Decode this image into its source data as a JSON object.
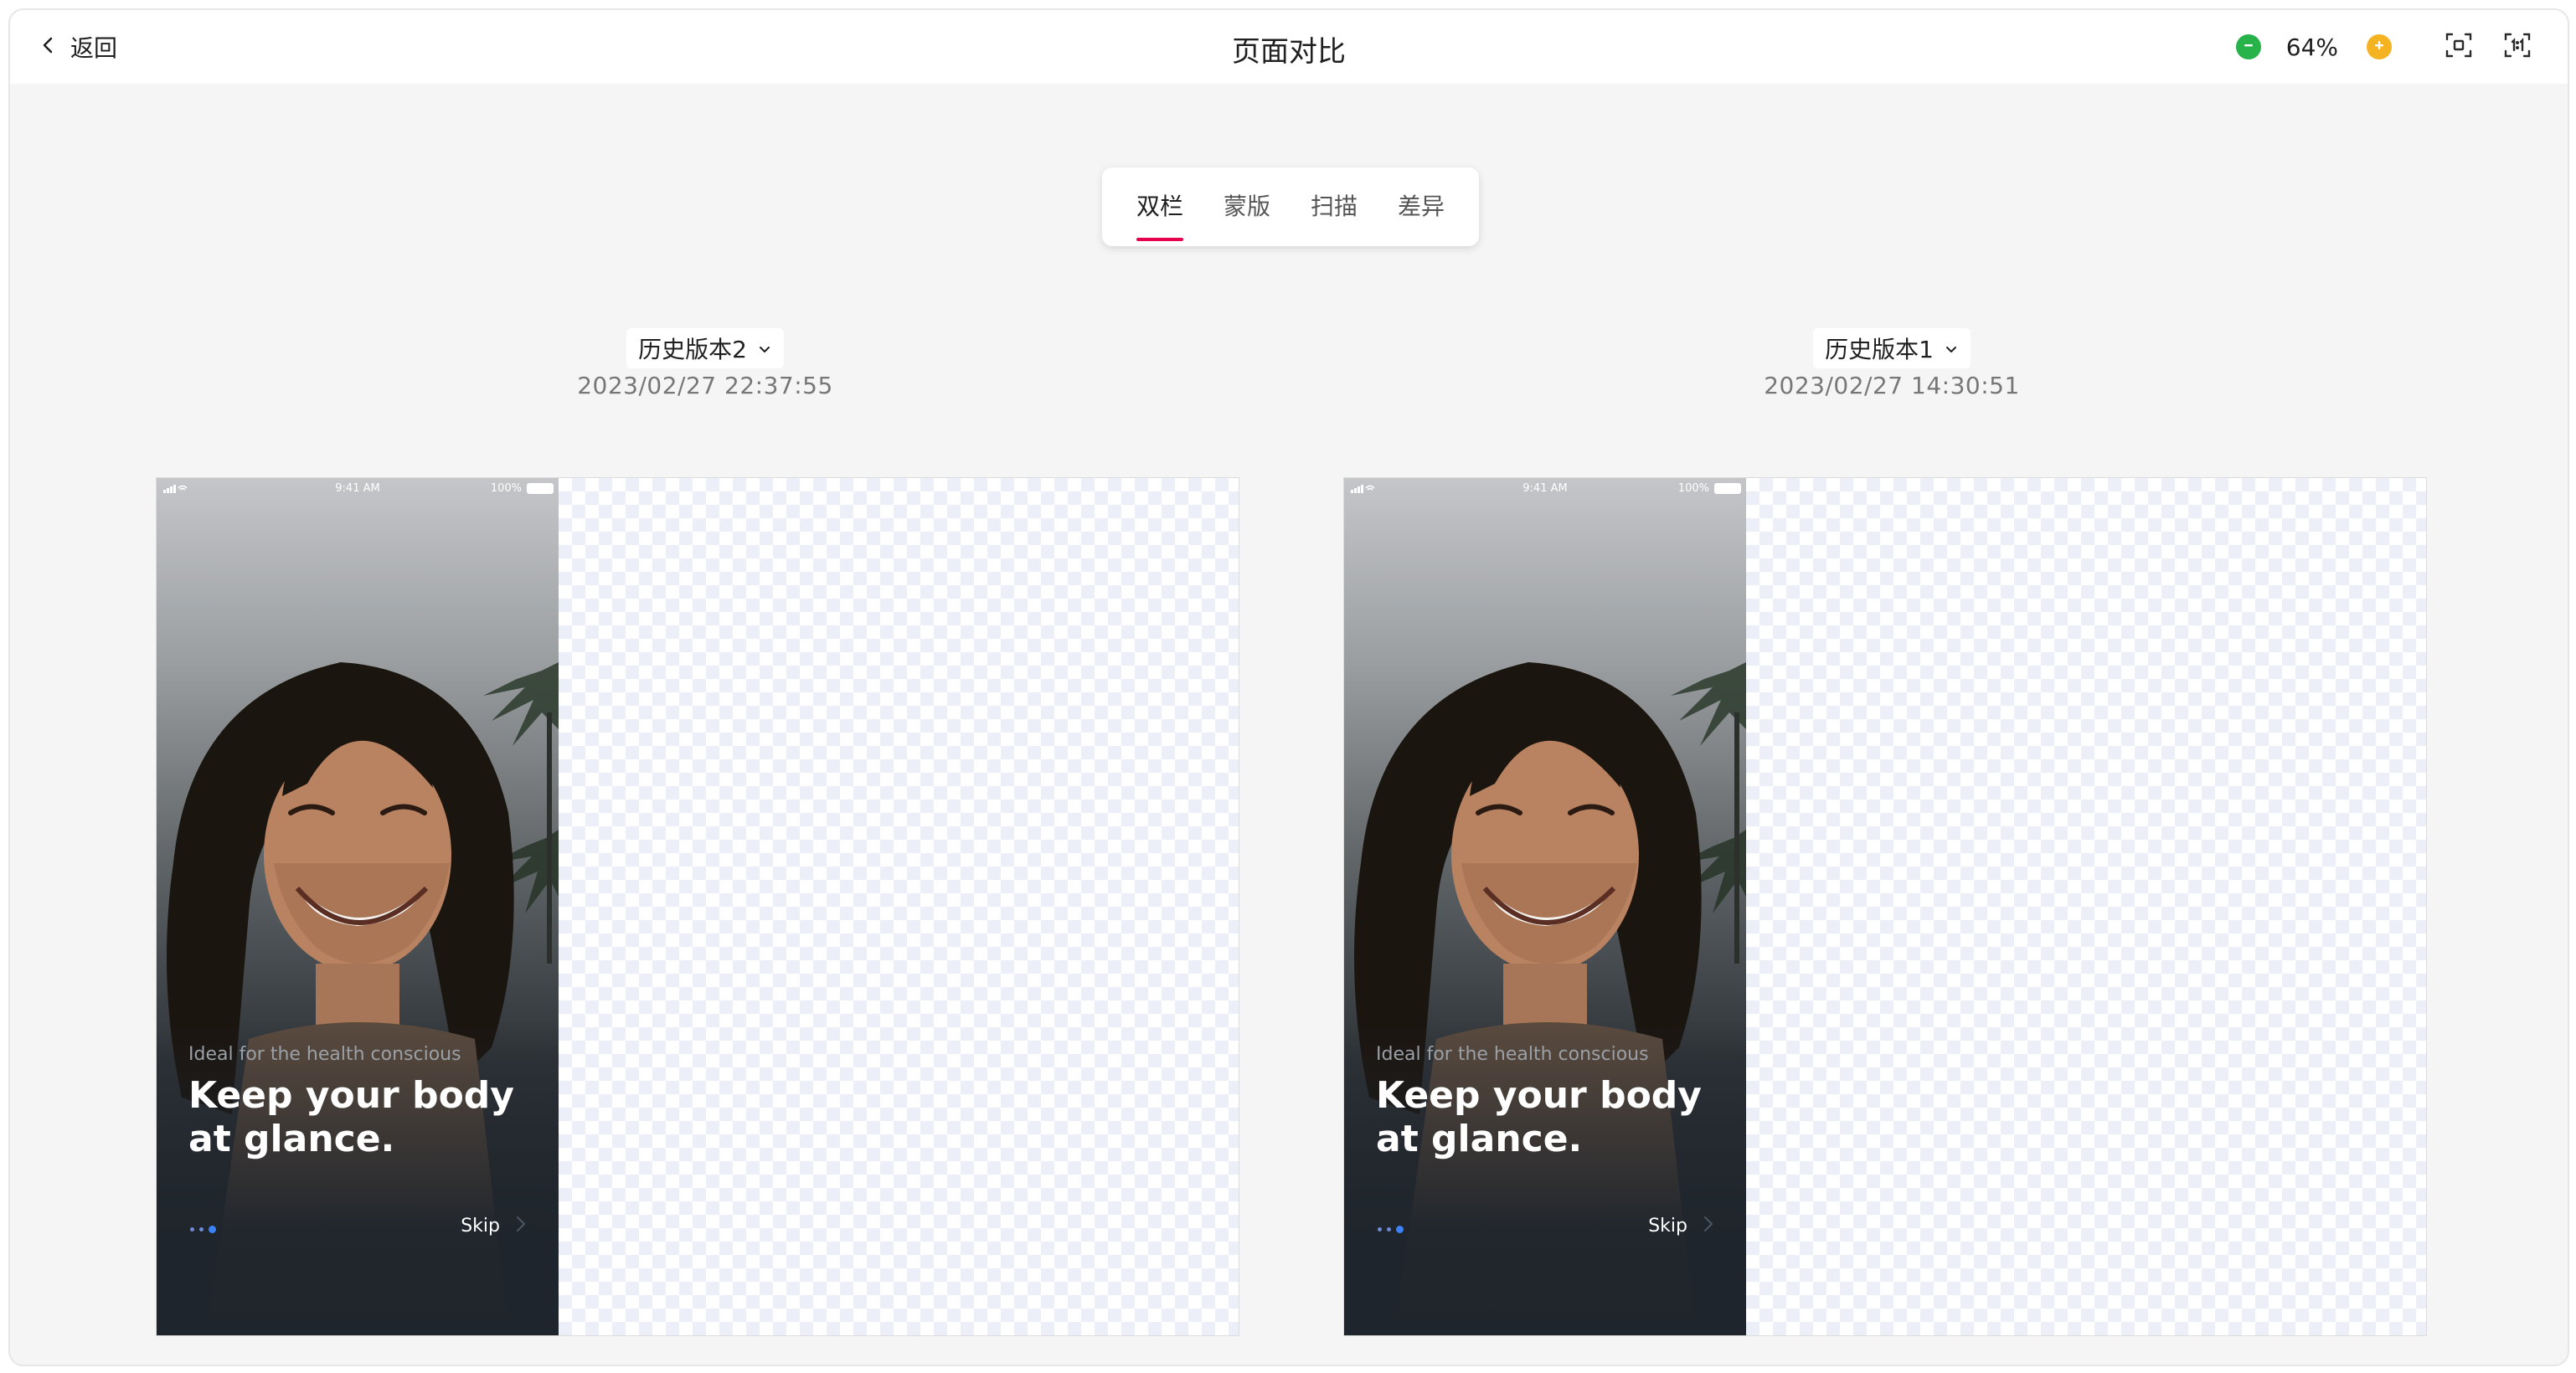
{
  "header": {
    "back_label": "返回",
    "title": "页面对比",
    "zoom_level": "64%"
  },
  "tabs": [
    {
      "label": "双栏",
      "active": true
    },
    {
      "label": "蒙版",
      "active": false
    },
    {
      "label": "扫描",
      "active": false
    },
    {
      "label": "差异",
      "active": false
    }
  ],
  "versions": [
    {
      "label": "历史版本2",
      "date": "2023/02/27 22:37:55"
    },
    {
      "label": "历史版本1",
      "date": "2023/02/27 14:30:51"
    }
  ],
  "phone_screen": {
    "status_time": "9:41 AM",
    "battery": "100%",
    "subheading": "Ideal for the health conscious",
    "headline_line1": "Keep your body",
    "headline_line2": "at glance.",
    "skip_label": "Skip"
  },
  "colors": {
    "accent": "#e6004c",
    "zoom_out": "#27b24a",
    "zoom_in": "#f6b321",
    "pager_active": "#3b82f6"
  },
  "icons": {
    "back": "chevron-left-icon",
    "zoom_out": "minus-circle-icon",
    "zoom_in": "plus-circle-icon",
    "fit": "fit-screen-icon",
    "actual_size": "actual-size-icon",
    "dropdown": "chevron-down-icon",
    "skip": "chevron-right-icon"
  }
}
